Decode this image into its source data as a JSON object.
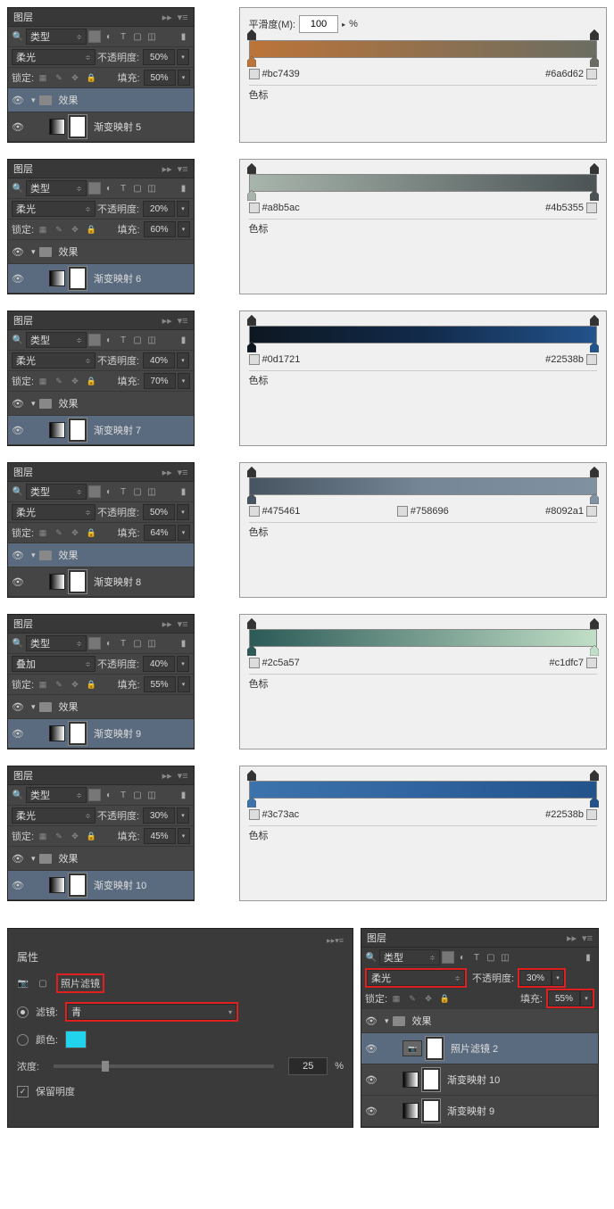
{
  "panels": [
    {
      "blend": "柔光",
      "opacity": "50%",
      "fill": "50%",
      "layer": "渐变映射 5",
      "grad": {
        "smooth": "100",
        "c1": "#bc7439",
        "c2": "#6a6d62",
        "g": "linear-gradient(to right,#bc7439,#6a6d62)"
      }
    },
    {
      "blend": "柔光",
      "opacity": "20%",
      "fill": "60%",
      "layer": "渐变映射 6",
      "grad": {
        "c1": "#a8b5ac",
        "c2": "#4b5355",
        "g": "linear-gradient(to right,#a8b5ac,#4b5355)"
      }
    },
    {
      "blend": "柔光",
      "opacity": "40%",
      "fill": "70%",
      "layer": "渐变映射 7",
      "grad": {
        "c1": "#0d1721",
        "c2": "#22538b",
        "g": "linear-gradient(to right,#0d1721,#122a4a,#22538b)"
      }
    },
    {
      "blend": "柔光",
      "opacity": "50%",
      "fill": "64%",
      "layer": "渐变映射 8",
      "grad": {
        "c1": "#475461",
        "c2": "#758696",
        "c3": "#8092a1",
        "g": "linear-gradient(to right,#475461,#758696,#8092a1)"
      }
    },
    {
      "blend": "叠加",
      "opacity": "40%",
      "fill": "55%",
      "layer": "渐变映射 9",
      "grad": {
        "c1": "#2c5a57",
        "c2": "#c1dfc7",
        "g": "linear-gradient(to right,#2c5a57,#c1dfc7)"
      }
    },
    {
      "blend": "柔光",
      "opacity": "30%",
      "fill": "45%",
      "layer": "渐变映射 10",
      "grad": {
        "c1": "#3c73ac",
        "c2": "#22538b",
        "g": "linear-gradient(to right,#3c73ac,#3064a0,#22538b)"
      }
    }
  ],
  "labels": {
    "layers_tab": "图层",
    "type": "类型",
    "opacity": "不透明度:",
    "fill": "填充:",
    "lock": "锁定:",
    "effects": "效果",
    "smooth": "平滑度(M):",
    "color_stop": "色标",
    "pct": "%",
    "props": "属性",
    "photo_filter": "照片滤镜",
    "filter": "滤镜:",
    "cyan": "青",
    "color": "颜色:",
    "density": "浓度:",
    "density_val": "25",
    "preserve": "保留明度",
    "photo_filter_layer": "照片滤镜 2",
    "grad_map_10": "渐变映射 10",
    "grad_map_9": "渐变映射 9",
    "right_blend": "柔光",
    "right_opacity": "30%",
    "right_fill": "55%"
  }
}
